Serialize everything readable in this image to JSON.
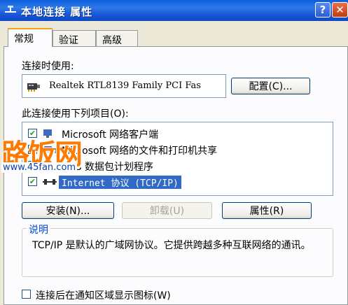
{
  "window": {
    "title": "本地连接 属性",
    "help_glyph": "?",
    "close_glyph": "✕"
  },
  "tabs": [
    {
      "label": "常规",
      "active": true
    },
    {
      "label": "验证",
      "active": false
    },
    {
      "label": "高级",
      "active": false
    }
  ],
  "connect_using": {
    "label": "连接时使用:",
    "device_name": "Realtek RTL8139 Family PCI Fas",
    "configure_label": "配置(C)..."
  },
  "items_section": {
    "label": "此连接使用下列项目(O):",
    "items": [
      {
        "label": "Microsoft 网络客户端",
        "checked": true,
        "icon": "network-client-icon"
      },
      {
        "label": "Microsoft 网络的文件和打印机共享",
        "checked": true,
        "icon": "file-share-icon"
      },
      {
        "label": "QoS 数据包计划程序",
        "checked": true,
        "icon": "qos-icon"
      },
      {
        "label": "Internet 协议 (TCP/IP)",
        "checked": true,
        "icon": "protocol-icon",
        "selected": true
      }
    ]
  },
  "buttons": {
    "install": "安装(N)...",
    "uninstall": "卸载(U)",
    "properties": "属性(R)"
  },
  "description": {
    "legend": "说明",
    "text": "TCP/IP 是默认的广域网协议。它提供跨越多种互联网络的通讯。"
  },
  "notify": {
    "label": "连接后在通知区域显示图标(W)",
    "checked": false
  },
  "watermark": {
    "logo_text": "路饭网",
    "url": "www.45fan.com"
  },
  "colors": {
    "titlebar": "#0A5DDB",
    "selection": "#316AC5",
    "tab_highlight": "#F5A60F",
    "watermark": "#FF7A00"
  }
}
